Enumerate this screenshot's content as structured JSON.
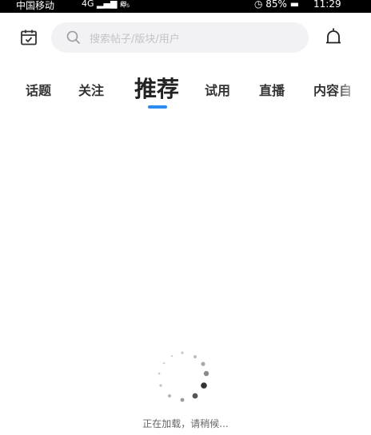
{
  "status_bar": {
    "carrier": "中国移动",
    "signal": "4G ▂▄▆ ≋",
    "speed": "K/s",
    "battery": "◷ 85% ▬",
    "time": "11:29"
  },
  "header": {
    "search_placeholder": "搜索帖子/版块/用户"
  },
  "tabs": [
    {
      "label": "话题",
      "active": false
    },
    {
      "label": "关注",
      "active": false
    },
    {
      "label": "推荐",
      "active": true
    },
    {
      "label": "试用",
      "active": false
    },
    {
      "label": "直播",
      "active": false
    },
    {
      "label": "内容自",
      "active": false
    }
  ],
  "loading": {
    "text": "正在加载，请稍候..."
  },
  "colors": {
    "accent": "#2d8cf0",
    "search_bg": "#f2f2f4"
  },
  "icons": [
    "calendar-icon",
    "search-icon",
    "bell-icon",
    "loading-spinner-icon"
  ]
}
